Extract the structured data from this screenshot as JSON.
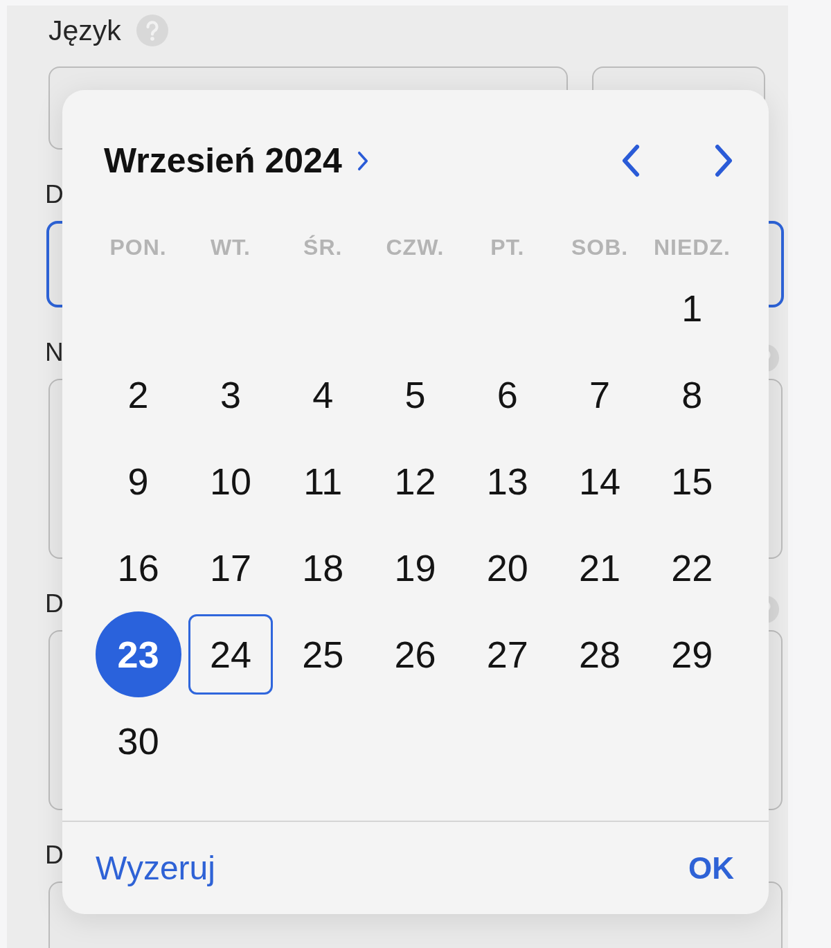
{
  "form": {
    "groups": [
      {
        "label": "Język",
        "kind": "split",
        "help_icon": true,
        "focused": false
      },
      {
        "label": "D",
        "kind": "single",
        "help_icon": false,
        "focused": true
      },
      {
        "label": "N",
        "kind": "tall",
        "help_icon": true,
        "focused": false
      },
      {
        "label": "D",
        "kind": "tall",
        "help_icon": true,
        "focused": false
      },
      {
        "label": "D",
        "kind": "tall",
        "help_icon": false,
        "focused": false
      }
    ]
  },
  "date_picker": {
    "title": "Wrzesień 2024",
    "weekdays": [
      "PON.",
      "WT.",
      "ŚR.",
      "CZW.",
      "PT.",
      "SOB.",
      "NIEDZ."
    ],
    "weeks": [
      [
        {
          "day": "1",
          "selected": false,
          "focused": false
        }
      ],
      [
        {
          "day": "2",
          "selected": false,
          "focused": false
        },
        {
          "day": "3",
          "selected": false,
          "focused": false
        },
        {
          "day": "4",
          "selected": false,
          "focused": false
        },
        {
          "day": "5",
          "selected": false,
          "focused": false
        },
        {
          "day": "6",
          "selected": false,
          "focused": false
        },
        {
          "day": "7",
          "selected": false,
          "focused": false
        },
        {
          "day": "8",
          "selected": false,
          "focused": false
        }
      ],
      [
        {
          "day": "9",
          "selected": false,
          "focused": false
        },
        {
          "day": "10",
          "selected": false,
          "focused": false
        },
        {
          "day": "11",
          "selected": false,
          "focused": false
        },
        {
          "day": "12",
          "selected": false,
          "focused": false
        },
        {
          "day": "13",
          "selected": false,
          "focused": false
        },
        {
          "day": "14",
          "selected": false,
          "focused": false
        },
        {
          "day": "15",
          "selected": false,
          "focused": false
        }
      ],
      [
        {
          "day": "16",
          "selected": false,
          "focused": false
        },
        {
          "day": "17",
          "selected": false,
          "focused": false
        },
        {
          "day": "18",
          "selected": false,
          "focused": false
        },
        {
          "day": "19",
          "selected": false,
          "focused": false
        },
        {
          "day": "20",
          "selected": false,
          "focused": false
        },
        {
          "day": "21",
          "selected": false,
          "focused": false
        },
        {
          "day": "22",
          "selected": false,
          "focused": false
        }
      ],
      [
        {
          "day": "23",
          "selected": true,
          "focused": false
        },
        {
          "day": "24",
          "selected": false,
          "focused": true
        },
        {
          "day": "25",
          "selected": false,
          "focused": false
        },
        {
          "day": "26",
          "selected": false,
          "focused": false
        },
        {
          "day": "27",
          "selected": false,
          "focused": false
        },
        {
          "day": "28",
          "selected": false,
          "focused": false
        },
        {
          "day": "29",
          "selected": false,
          "focused": false
        }
      ],
      [
        {
          "day": "30",
          "selected": false,
          "focused": false
        }
      ]
    ],
    "reset_button": "Wyzeruj",
    "ok_button": "OK"
  }
}
